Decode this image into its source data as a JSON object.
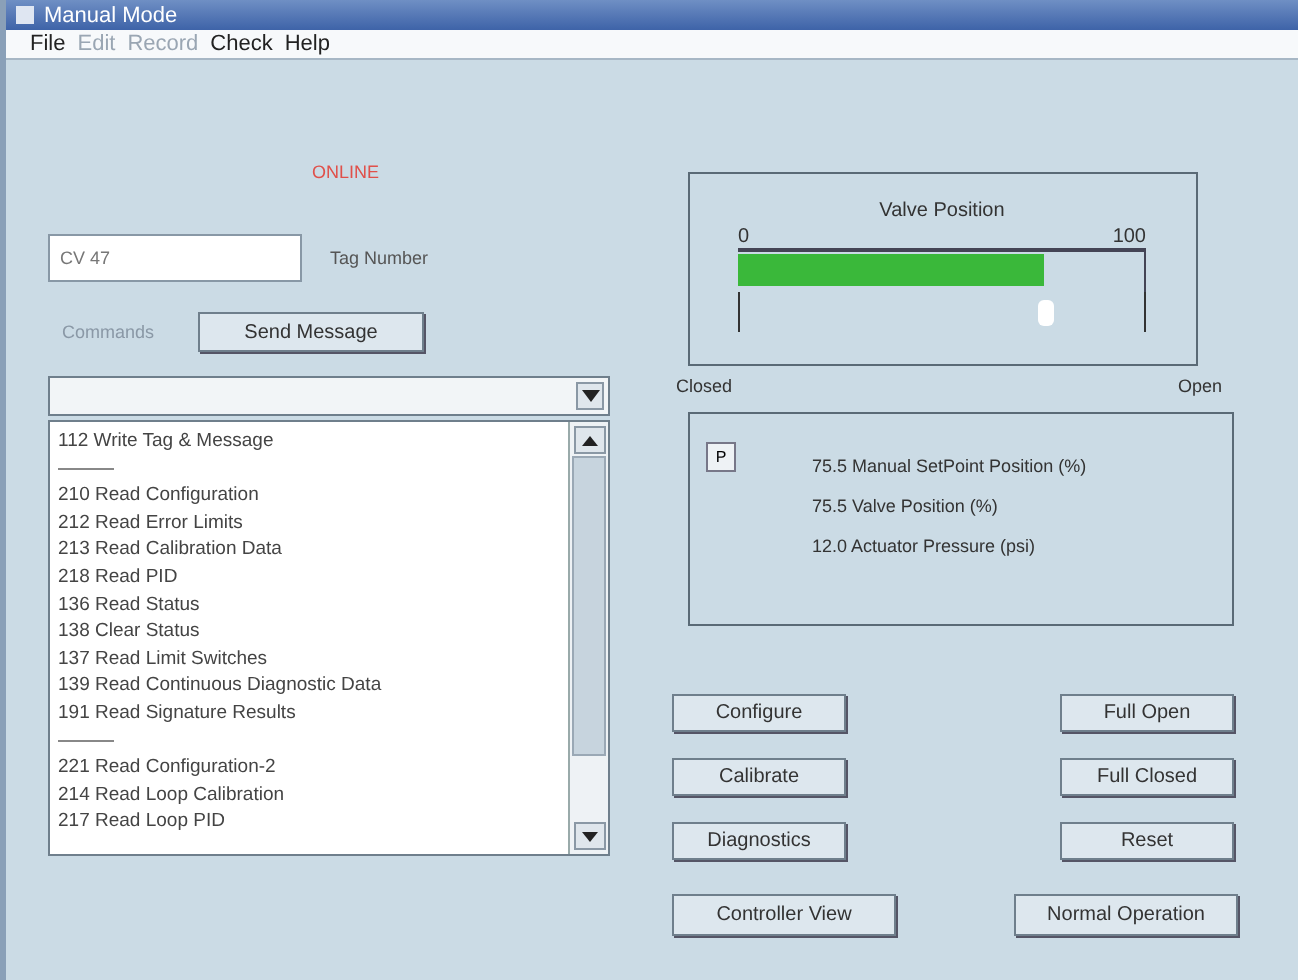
{
  "window": {
    "title": "Manual Mode"
  },
  "menu": [
    {
      "label": "File",
      "disabled": false
    },
    {
      "label": "Edit",
      "disabled": true
    },
    {
      "label": "Record",
      "disabled": true
    },
    {
      "label": "Check",
      "disabled": false
    },
    {
      "label": "Help",
      "disabled": false
    }
  ],
  "status": "ONLINE",
  "tag": {
    "value": "CV 47",
    "label": "Tag Number"
  },
  "commands": {
    "label": "Commands",
    "button": "Send Message"
  },
  "command_list": [
    {
      "kind": "command",
      "label": "112 Write Tag & Message"
    },
    {
      "kind": "separator"
    },
    {
      "kind": "command",
      "label": "210 Read Configuration"
    },
    {
      "kind": "command",
      "label": "212 Read Error Limits"
    },
    {
      "kind": "command",
      "label": "213 Read Calibration Data"
    },
    {
      "kind": "command",
      "label": "218 Read PID"
    },
    {
      "kind": "command",
      "label": "136 Read Status"
    },
    {
      "kind": "command",
      "label": "138 Clear Status"
    },
    {
      "kind": "command",
      "label": "137 Read Limit Switches"
    },
    {
      "kind": "command",
      "label": "139 Read Continuous Diagnostic Data"
    },
    {
      "kind": "command",
      "label": "191 Read Signature Results"
    },
    {
      "kind": "separator"
    },
    {
      "kind": "command",
      "label": "221 Read Configuration-2"
    },
    {
      "kind": "command",
      "label": "214 Read Loop Calibration"
    },
    {
      "kind": "command",
      "label": "217 Read Loop PID"
    }
  ],
  "valve": {
    "title": "Valve Position",
    "min": "0",
    "max": "100",
    "level": 0.755,
    "closed_label": "Closed",
    "open_label": "Open"
  },
  "readout": {
    "button": "P",
    "lines": [
      "75.5 Manual SetPoint Position (%)",
      "75.5 Valve Position (%)",
      "12.0 Actuator Pressure (psi)"
    ]
  },
  "buttons_left": [
    "Configure",
    "Calibrate",
    "Diagnostics"
  ],
  "buttons_right": [
    "Full Open",
    "Full Closed",
    "Reset"
  ],
  "bottom_buttons": [
    "Controller View",
    "Normal Operation"
  ]
}
